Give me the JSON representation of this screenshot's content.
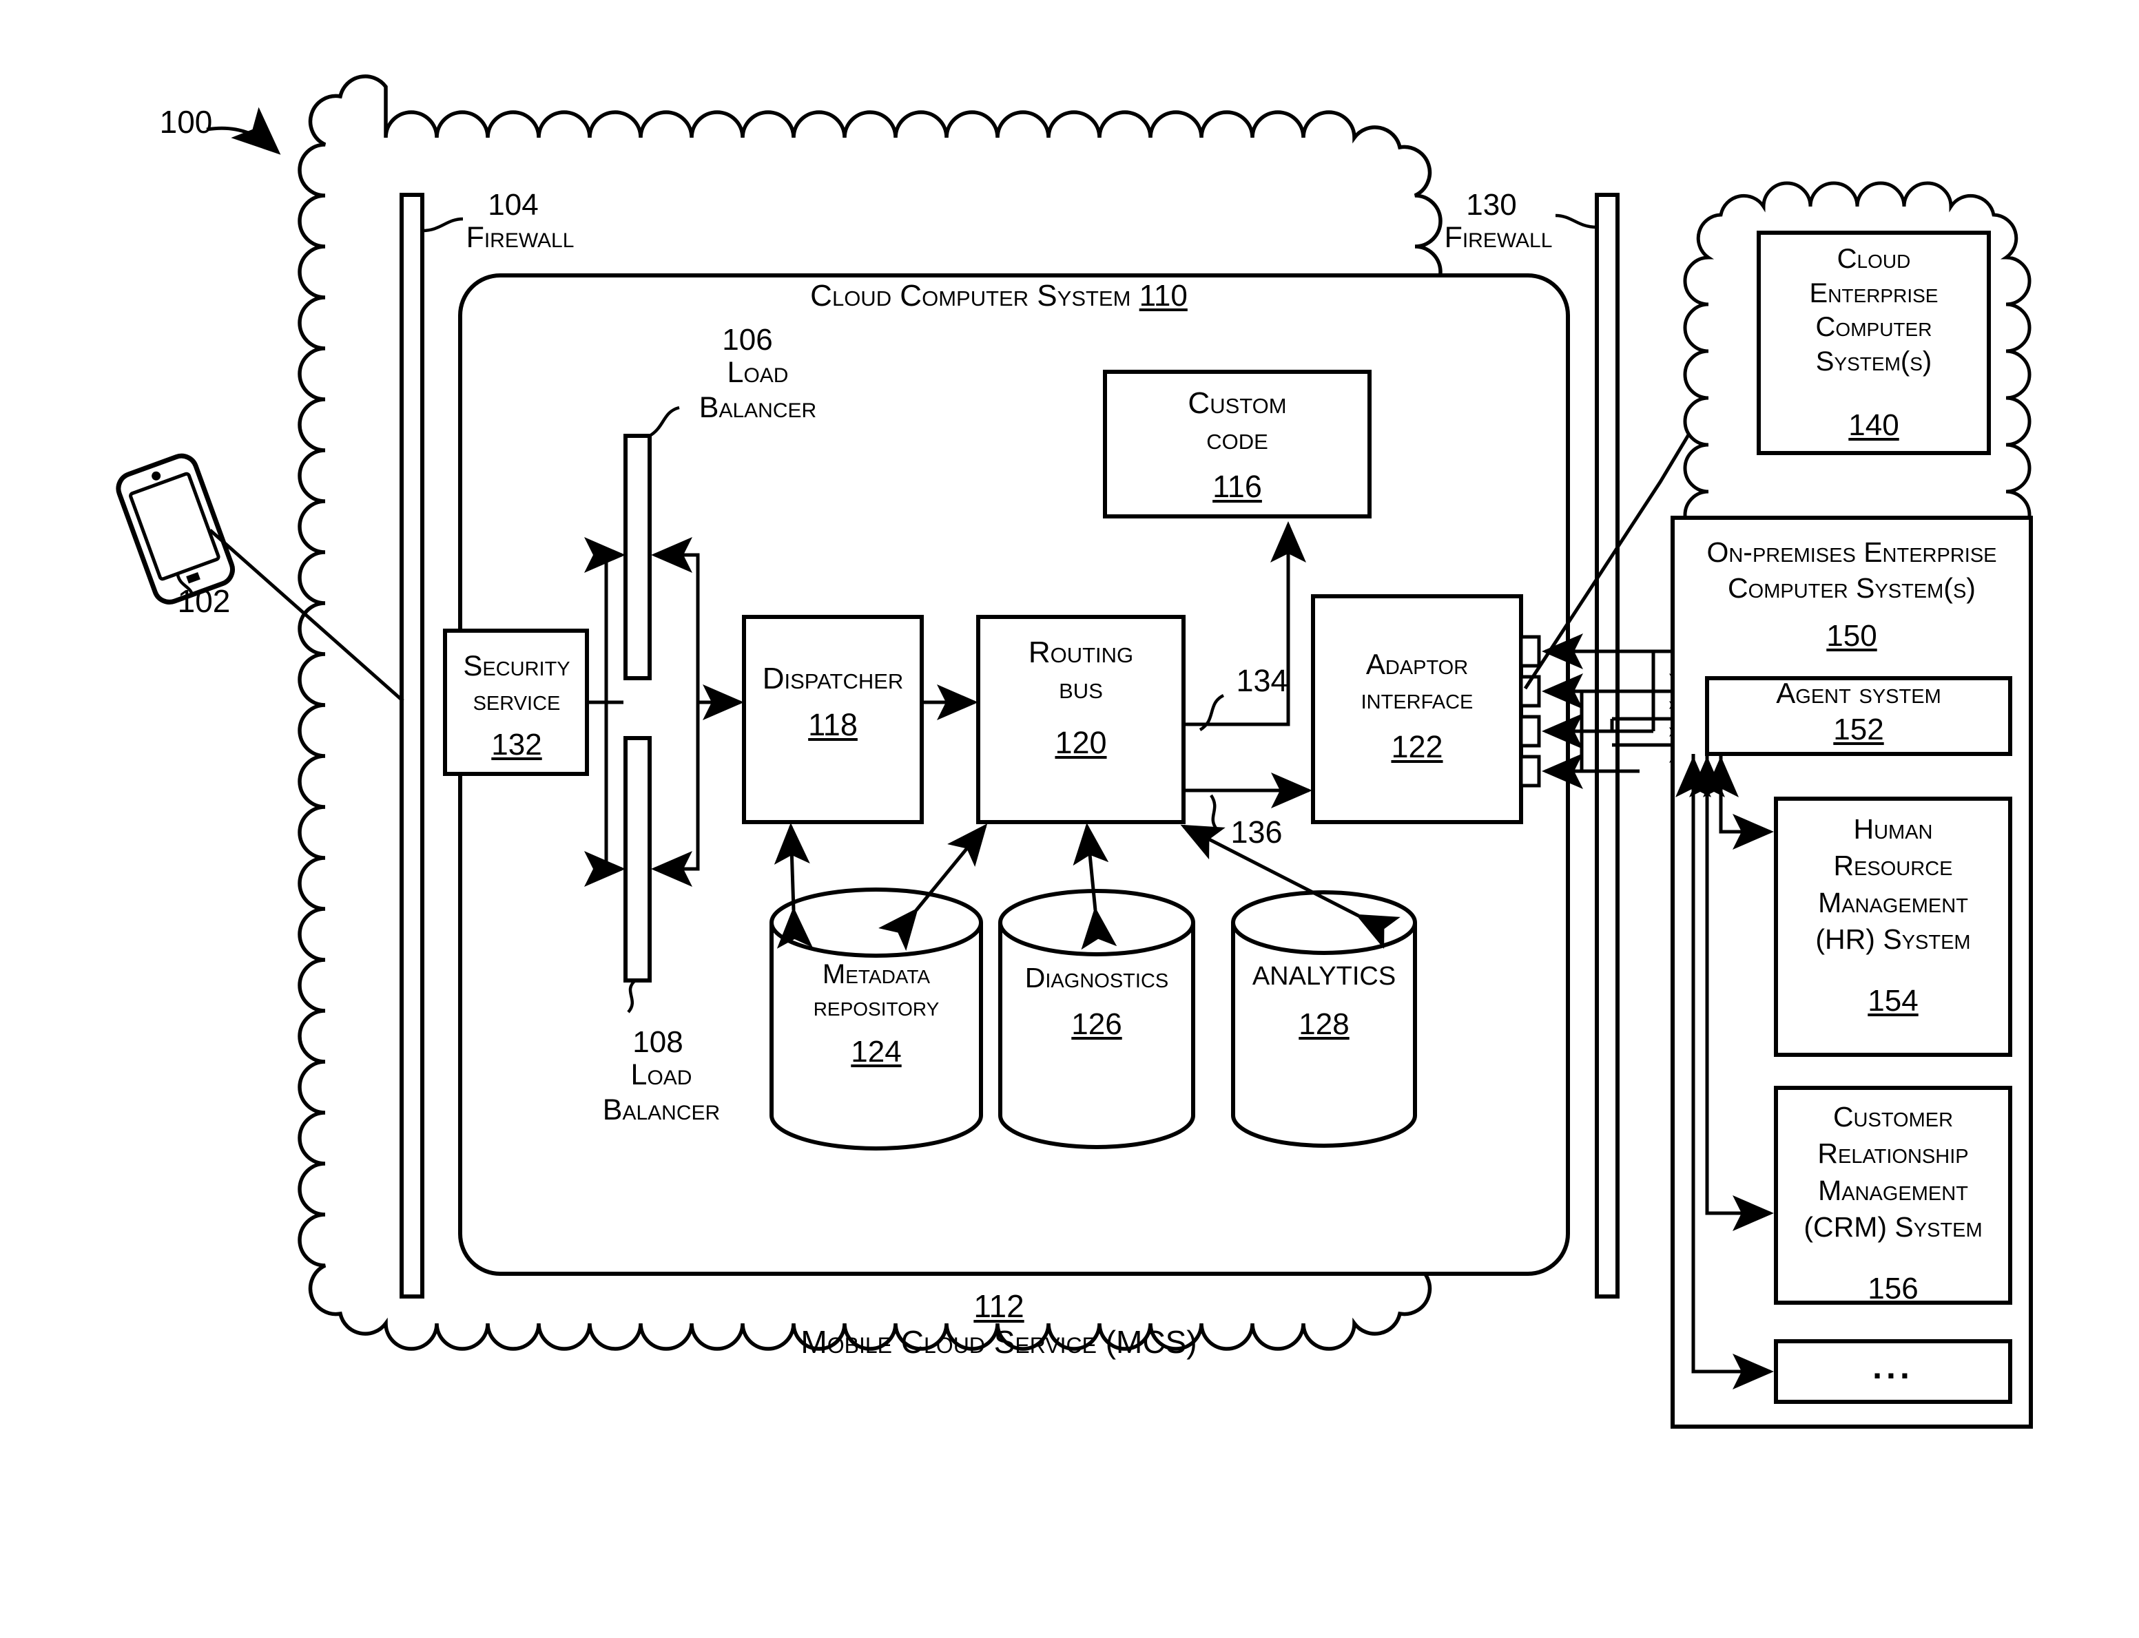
{
  "figure": {
    "figure_ref": "100",
    "outer_cloud_label": {
      "ref": "112",
      "name": "Mobile Cloud Service (MCS)"
    }
  },
  "client": {
    "device_icon": "mobile-phone-icon",
    "ref": "102"
  },
  "firewalls": [
    {
      "ref": "104",
      "name": "Firewall",
      "position": "left"
    },
    {
      "ref": "130",
      "name": "Firewall",
      "position": "right"
    }
  ],
  "cloud_computer_system": {
    "title": "Cloud Computer System",
    "ref": "110"
  },
  "load_balancers": [
    {
      "ref": "106",
      "name": "Load\nBalancer",
      "position": "top"
    },
    {
      "ref": "108",
      "name": "Load\nBalancer",
      "position": "bottom"
    }
  ],
  "blocks": [
    {
      "id": "security-service",
      "title": "Security\nservice",
      "ref": "132"
    },
    {
      "id": "dispatcher",
      "title": "Dispatcher",
      "ref": "118"
    },
    {
      "id": "routing-bus",
      "title": "Routing\nbus",
      "ref": "120"
    },
    {
      "id": "custom-code",
      "title": "Custom\ncode",
      "ref": "116"
    },
    {
      "id": "adaptor-interface",
      "title": "Adaptor\ninterface",
      "ref": "122"
    }
  ],
  "datastores": [
    {
      "id": "metadata-repository",
      "title": "Metadata\nrepository",
      "ref": "124"
    },
    {
      "id": "diagnostics",
      "title": "Diagnostics",
      "ref": "126"
    },
    {
      "id": "analytics",
      "title": "ANALYTICS",
      "ref": "128"
    }
  ],
  "connector_refs": [
    {
      "ref": "134"
    },
    {
      "ref": "136"
    }
  ],
  "cloud_enterprise": {
    "title": "Cloud\nEnterprise\nComputer\nSystem(s)",
    "ref": "140"
  },
  "on_premises": {
    "title": "On-premises Enterprise\nComputer System(s)",
    "ref": "150",
    "children": [
      {
        "id": "agent-system",
        "title": "Agent system",
        "ref": "152"
      },
      {
        "id": "hr-system",
        "title": "Human\nResource\nManagement\n(HR) System",
        "ref": "154"
      },
      {
        "id": "crm-system",
        "title": "Customer\nRelationship\nManagement\n(CRM) System",
        "ref": "156"
      },
      {
        "id": "more-systems",
        "title": "...",
        "ref": ""
      }
    ]
  },
  "colors": {
    "ink": "#000000",
    "paper": "#ffffff"
  }
}
